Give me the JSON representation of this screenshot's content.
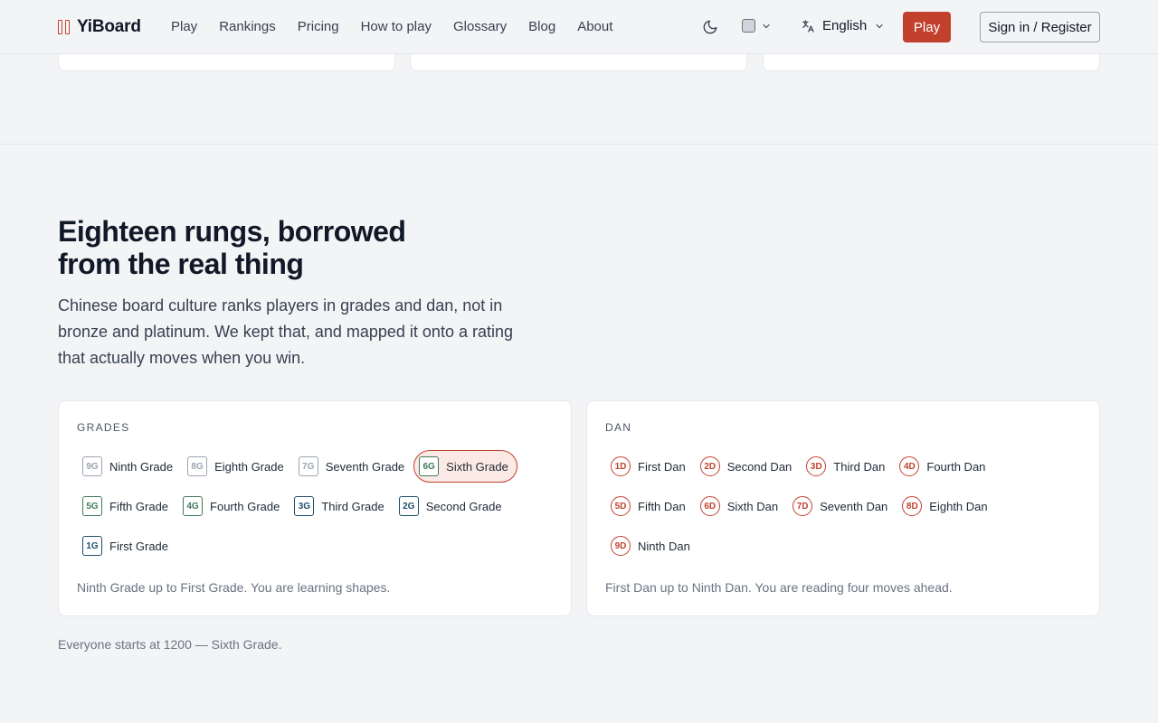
{
  "brand": {
    "name": "YiBoard",
    "accent": "#c2412d"
  },
  "nav": [
    "Play",
    "Rankings",
    "Pricing",
    "How to play",
    "Glossary",
    "Blog",
    "About"
  ],
  "header": {
    "theme_icon": "moon-icon",
    "board_icon": "board-square-icon",
    "language_icon": "translate-icon",
    "language": "English",
    "play_label": "Play",
    "signin_label": "Sign in / Register"
  },
  "section": {
    "title": "Eighteen rungs, borrowed from the real thing",
    "lede": "Chinese board culture ranks players in grades and dan, not in bronze and platinum. We kept that, and mapped it onto a rating that actually moves when you win."
  },
  "grades": {
    "label": "GRADES",
    "selected": "6G",
    "rows": [
      [
        {
          "code": "9G",
          "name": "Ninth Grade",
          "color": "#9ca3af"
        },
        {
          "code": "8G",
          "name": "Eighth Grade",
          "color": "#9ca3af"
        },
        {
          "code": "7G",
          "name": "Seventh Grade",
          "color": "#9ca3af"
        },
        {
          "code": "6G",
          "name": "Sixth Grade",
          "color": "#3f7a5a"
        }
      ],
      [
        {
          "code": "5G",
          "name": "Fifth Grade",
          "color": "#3f7a5a"
        },
        {
          "code": "4G",
          "name": "Fourth Grade",
          "color": "#3f7a5a"
        },
        {
          "code": "3G",
          "name": "Third Grade",
          "color": "#1f4e6b"
        },
        {
          "code": "2G",
          "name": "Second Grade",
          "color": "#1f4e6b"
        }
      ],
      [
        {
          "code": "1G",
          "name": "First Grade",
          "color": "#1f4e6b"
        }
      ]
    ],
    "note": "Ninth Grade up to First Grade. You are learning shapes."
  },
  "dan": {
    "label": "DAN",
    "rows": [
      [
        {
          "code": "1D",
          "name": "First Dan"
        },
        {
          "code": "2D",
          "name": "Second Dan"
        },
        {
          "code": "3D",
          "name": "Third Dan"
        },
        {
          "code": "4D",
          "name": "Fourth Dan"
        }
      ],
      [
        {
          "code": "5D",
          "name": "Fifth Dan"
        },
        {
          "code": "6D",
          "name": "Sixth Dan"
        },
        {
          "code": "7D",
          "name": "Seventh Dan"
        },
        {
          "code": "8D",
          "name": "Eighth Dan"
        }
      ],
      [
        {
          "code": "9D",
          "name": "Ninth Dan"
        }
      ]
    ],
    "note": "First Dan up to Ninth Dan. You are reading four moves ahead."
  },
  "footnote": "Everyone starts at 1200 — Sixth Grade."
}
